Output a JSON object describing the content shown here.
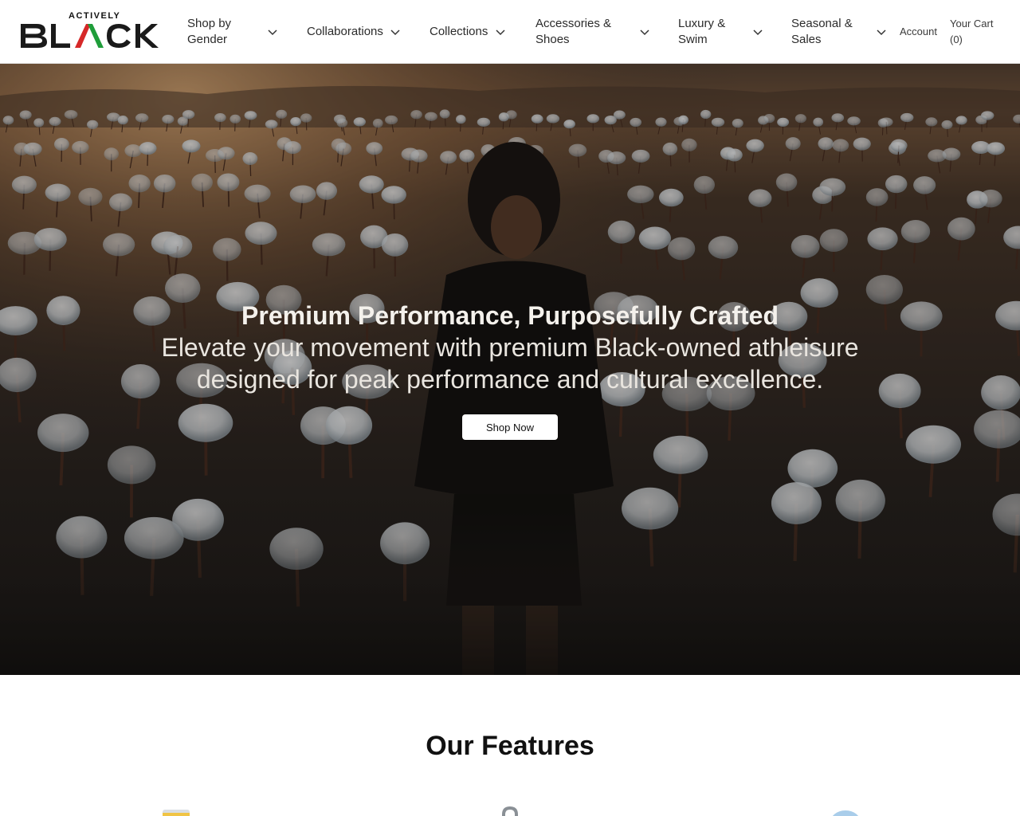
{
  "brand": {
    "tagline": "ACTIVELY",
    "letters": [
      "B",
      "L",
      "C",
      "K"
    ],
    "colors": {
      "dark": "#1a1a1a",
      "red": "#d62828",
      "green": "#1f9d3a"
    }
  },
  "nav": {
    "items": [
      {
        "label": "Shop by Gender",
        "line1": "Shop by",
        "line2": "Gender"
      },
      {
        "label": "Collaborations",
        "line1": "Collaborations",
        "line2": ""
      },
      {
        "label": "Collections",
        "line1": "Collections",
        "line2": ""
      },
      {
        "label": "Accessories & Shoes",
        "line1": "Accessories &",
        "line2": "Shoes"
      },
      {
        "label": "Luxury & Swim",
        "line1": "Luxury &",
        "line2": "Swim"
      },
      {
        "label": "Seasonal & Sales",
        "line1": "Seasonal &",
        "line2": "Sales"
      }
    ],
    "account": "Account",
    "cart": {
      "line1": "Your Cart",
      "line2": "(0)",
      "count": 0
    }
  },
  "hero": {
    "title": "Premium Performance, Purposefully Crafted",
    "subtitle": "Elevate your movement with premium Black-owned athleisure designed for peak performance and cultural excellence.",
    "cta": "Shop Now"
  },
  "features": {
    "heading": "Our Features",
    "icons": [
      "card-icon",
      "lock-icon",
      "chat-bubble-icon"
    ]
  }
}
